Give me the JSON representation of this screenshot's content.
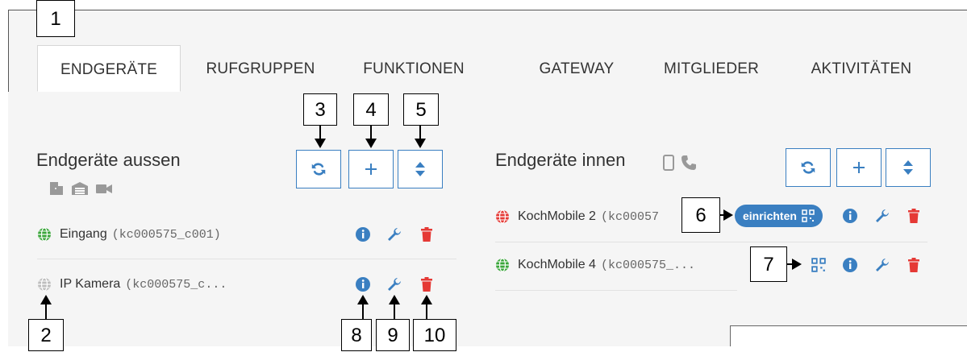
{
  "tabs": [
    {
      "label": "ENDGERÄTE",
      "active": true
    },
    {
      "label": "RUFGRUPPEN",
      "active": false
    },
    {
      "label": "FUNKTIONEN",
      "active": false
    },
    {
      "label": "GATEWAY",
      "active": false
    },
    {
      "label": "MITGLIEDER",
      "active": false
    },
    {
      "label": "AKTIVITÄTEN",
      "active": false
    }
  ],
  "outside": {
    "title": "Endgeräte aussen",
    "type_icons": [
      "door-icon",
      "garage-icon",
      "camera-icon"
    ],
    "buttons": [
      "refresh-icon",
      "plus-icon",
      "sort-icon"
    ],
    "devices": [
      {
        "name": "Eingang",
        "id": "(kc000575_c001)",
        "status": "online",
        "actions": [
          "info-icon",
          "wrench-icon",
          "trash-icon"
        ]
      },
      {
        "name": "IP Kamera",
        "id": "(kc000575_c...",
        "status": "unknown",
        "actions": [
          "info-icon",
          "wrench-icon",
          "trash-icon"
        ]
      }
    ]
  },
  "inside": {
    "title": "Endgeräte innen",
    "type_icons": [
      "mobile-icon",
      "phone-icon"
    ],
    "buttons": [
      "refresh-icon",
      "plus-icon",
      "sort-icon"
    ],
    "devices": [
      {
        "name": "KochMobile 2",
        "id": "(kc00057",
        "status": "offline",
        "setup_label": "einrichten",
        "actions": [
          "qr-icon",
          "info-icon",
          "wrench-icon",
          "trash-icon"
        ]
      },
      {
        "name": "KochMobile 4",
        "id": "(kc000575_...",
        "status": "online",
        "actions": [
          "qr-icon",
          "info-icon",
          "wrench-icon",
          "trash-icon"
        ]
      }
    ]
  },
  "callouts": [
    "1",
    "2",
    "3",
    "4",
    "5",
    "6",
    "7",
    "8",
    "9",
    "10"
  ],
  "colors": {
    "accent": "#3a7fc1",
    "online": "#3aa63a",
    "offline": "#e53935",
    "unknown": "#bdbdbd",
    "delete": "#e53935"
  }
}
